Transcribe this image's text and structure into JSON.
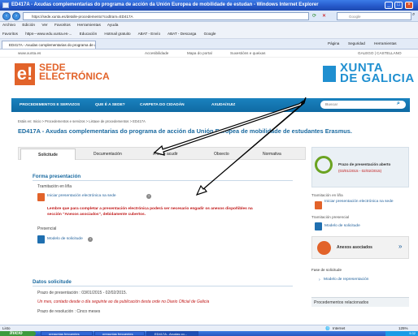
{
  "window": {
    "title": "ED417A - Axudas complementarias do programa de acción da Unión Europea de mobilidade de estudan - Windows Internet Explorer"
  },
  "browser": {
    "address": "https://sede.xunta.es/detalle-procedemento?codtram=ED417A",
    "search_placeholder": "Google",
    "menu": [
      "Archivo",
      "Edición",
      "Ver",
      "Favoritos",
      "Herramientas",
      "Ayuda"
    ],
    "favorites": [
      "Favoritos",
      "https---www.edu.xunta.es-...",
      "Educación",
      "Hotmail gratuito",
      "ABAT - Envío",
      "ABAT - Descarga",
      "Google"
    ],
    "tab_title": "ED417A - Axudas complementarias do programa de a...",
    "tools": [
      "Página",
      "Seguridad",
      "Herramientas"
    ]
  },
  "site": {
    "url_text": "www.xunta.es",
    "util_links": [
      "Accesibilidade",
      "Mapa do portal",
      "Suxestións e queixas"
    ],
    "lang": "GALEGO | CASTELLANO",
    "logo_letter": "e!",
    "sede_line1": "SEDE",
    "sede_line2": "ELECTRÓNICA",
    "xunta_line1": "XUNTA",
    "xunta_line2": "DE GALICIA",
    "nav": [
      "PROCEDEMENTOS E SERVIZOS",
      "QUE É A SEDE?",
      "CARPETA DO CIDADÁN",
      "AXUDA/XUIZ"
    ],
    "nav_search": "Buscar"
  },
  "page": {
    "breadcrumb": "Estás en: Inicio > Procedementos e servizos > Listaxe de procedementos > ED417A",
    "title": "ED417A - Axudas complementarias do programa de acción da Unión Europea de mobilidade de estudantes Erasmus.",
    "tabs": [
      "Solicitude",
      "Documentación",
      "A onde acudir",
      "Obxecto",
      "Normativa"
    ],
    "forma_heading": "Forma presentación",
    "tramitacion_label": "Tramitación en liña",
    "iniciar_link": "Iniciar presentación electrónica na sede",
    "warning_line1": "Lembre que para completar a presentación electrónica poderá ser necesario engadir os anexos dispoñibles na",
    "warning_line2": "sección \"Anexos asociados\", debidamente cubertos.",
    "presencial_label": "Presencial",
    "modelo_link": "Modelo de solicitude",
    "datos_heading": "Datos solicitude",
    "prazo_text": "Prazo de presentación : 03/01/2015 - 02/02/2015.",
    "prazo_note": "Un mes, contado desde o día seguinte ao da publicación desta orde no Diario Oficial de Galicia",
    "resolucion": "Prazo de resolución : Cinco meses"
  },
  "sidebar": {
    "prazo_title": "Prazo de presentación aberto",
    "prazo_dates": "(03/01/2015 - 02/02/2015)",
    "tram_label": "Tramitación en liña",
    "iniciar_link": "Iniciar presentación electrónica na sede",
    "tram_presencial": "Tramitación presencial",
    "modelo_link": "Modelo de solicitude",
    "anexos_label": "Anexos asociados",
    "anexos_arrow": "»",
    "fase_label": "Fase de solicitude",
    "fase_link": "Modelo de representación",
    "proc_relacionados": "Procedementos relacionados"
  },
  "statusbar": {
    "left": "Listo",
    "zone": "Internet",
    "zoom": "125%"
  },
  "taskbar": {
    "start": "Inicio",
    "tasks": [
      "preguntas frecuentes",
      "preguntas frecuentes",
      "ED417A - Axudas co..."
    ],
    "time": "9:32"
  },
  "colors": {
    "accent": "#e2632a",
    "nav_blue": "#1a82bf",
    "xunta_blue": "#1f8fd0",
    "warning_red": "#c01818"
  }
}
